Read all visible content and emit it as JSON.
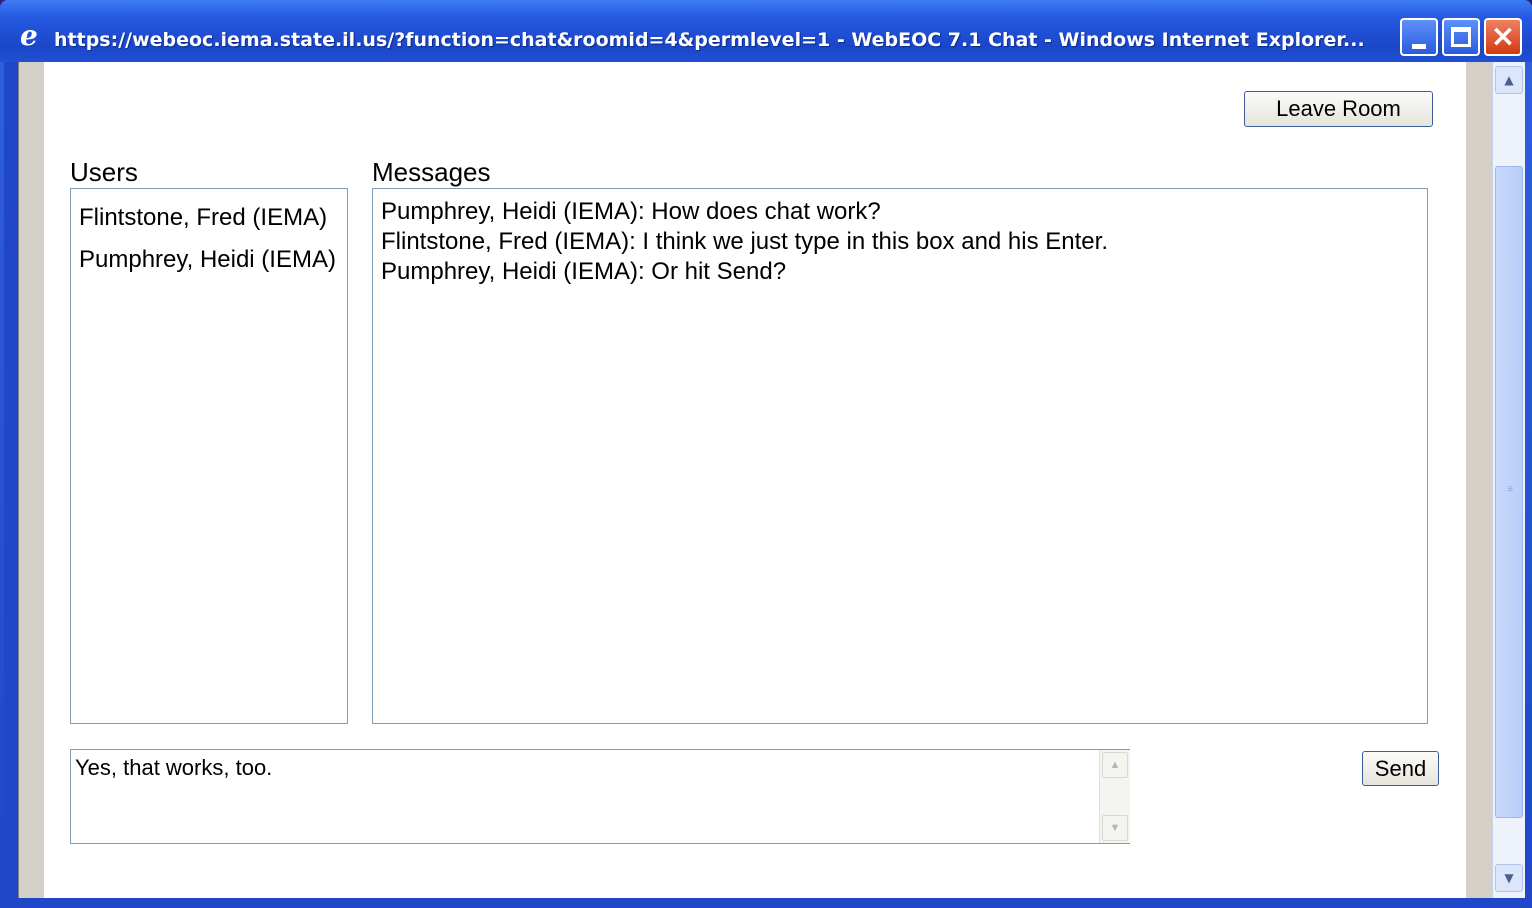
{
  "window": {
    "title": "https://webeoc.iema.state.il.us/?function=chat&roomid=4&permlevel=1 - WebEOC 7.1  Chat - Windows Internet Explorer...",
    "icon": "ie-icon",
    "controls": {
      "minimize": "minimize-icon",
      "maximize": "maximize-icon",
      "close": "×"
    }
  },
  "chat": {
    "leave_room_label": "Leave Room",
    "users_label": "Users",
    "messages_label": "Messages",
    "users": [
      "Flintstone, Fred (IEMA)",
      "Pumphrey, Heidi (IEMA)"
    ],
    "messages": [
      "Pumphrey, Heidi (IEMA): How does chat work?",
      "Flintstone, Fred (IEMA): I think we just type in this box and his Enter.",
      "Pumphrey, Heidi (IEMA): Or hit Send?"
    ],
    "input_value": "Yes, that works, too.",
    "send_label": "Send"
  },
  "colors": {
    "titlebar": "#2458e0",
    "close_button": "#d23a12",
    "gutter": "#d4d0c8",
    "box_border": "#7f9db9"
  }
}
